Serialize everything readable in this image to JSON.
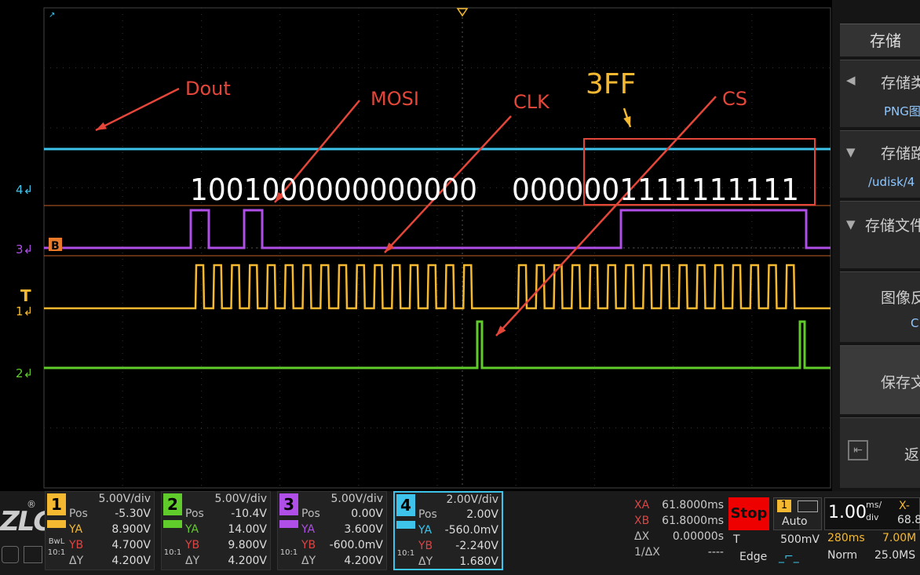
{
  "colors": {
    "ch1": "#f5b931",
    "ch2": "#5fcc2c",
    "ch3": "#b04ee8",
    "ch4": "#3ec3ea",
    "annotation": "#e5463a",
    "annotation_accent": "#f5b931"
  },
  "annotations": {
    "dout": "Dout",
    "mosi": "MOSI",
    "clk": "CLK",
    "cs": "CS",
    "hex": "3FF",
    "bits_mosi": "1001000000000000",
    "bits_dout": "0000001111111111"
  },
  "markers": {
    "ch4": "4",
    "ch3": "3",
    "ch1": "1",
    "ch2": "2",
    "bus": "B",
    "trigger": "T"
  },
  "menu": {
    "title": "存储",
    "items": [
      {
        "label": "存储类",
        "value": "PNG图"
      },
      {
        "label": "存储路",
        "value": "/udisk/4"
      },
      {
        "label": "存储文件",
        "value": ""
      },
      {
        "label": "图像反",
        "value": "C"
      },
      {
        "label": "保存文",
        "value": ""
      },
      {
        "label": "返",
        "value": ""
      }
    ]
  },
  "channels": [
    {
      "id": "1",
      "vdiv": "5.00V/div",
      "pos": "-5.30V",
      "ya": "8.900V",
      "yb": "4.700V",
      "dy": "4.200V",
      "side_top": "BwL",
      "side": "10:1"
    },
    {
      "id": "2",
      "vdiv": "5.00V/div",
      "pos": "-10.4V",
      "ya": "14.00V",
      "yb": "9.800V",
      "dy": "4.200V",
      "side_top": "",
      "side": "10:1"
    },
    {
      "id": "3",
      "vdiv": "5.00V/div",
      "pos": "0.00V",
      "ya": "3.600V",
      "yb": "-600.0mV",
      "dy": "4.200V",
      "side_top": "",
      "side": "10:1"
    },
    {
      "id": "4",
      "vdiv": "2.00V/div",
      "pos": "2.00V",
      "ya": "-560.0mV",
      "yb": "-2.240V",
      "dy": "1.680V",
      "side_top": "",
      "side": "10:1"
    }
  ],
  "labels": {
    "pos": "Pos",
    "ya": "YA",
    "yb": "YB",
    "dy": "ΔY"
  },
  "cursors": {
    "xa_k": "XA",
    "xa": "61.8000ms",
    "xb_k": "XB",
    "xb": "61.8000ms",
    "dx_k": "ΔX",
    "dx": "0.00000s",
    "inv_k": "1/ΔX",
    "inv": "----"
  },
  "run": {
    "stop": "Stop"
  },
  "trigger": {
    "source": "1",
    "mode": "Auto",
    "t": "T",
    "level": "500mV",
    "type": "Edge"
  },
  "timebase": {
    "value": "1.00",
    "unit_top": "ms/",
    "unit_bottom": "div",
    "x_label": "X-",
    "x_val": "68.8",
    "delay": "280ms",
    "mem": "7.00M",
    "acq": "Norm",
    "rate": "25.0MS"
  },
  "brand": "ZLG"
}
